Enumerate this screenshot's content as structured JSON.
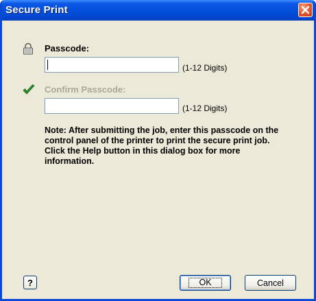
{
  "window": {
    "title": "Secure Print",
    "close_icon": "close-icon"
  },
  "passcode": {
    "label": "Passcode:",
    "value": "",
    "hint": "(1-12 Digits)",
    "icon": "lock-icon"
  },
  "confirm": {
    "label": "Confirm Passcode:",
    "value": "",
    "hint": "(1-12 Digits)",
    "icon": "checkmark-icon",
    "enabled": false
  },
  "note": "Note: After submitting the job, enter this passcode on the control panel of the printer to print the secure print job.  Click the Help button in this dialog box for more information.",
  "buttons": {
    "help": "?",
    "ok": "OK",
    "cancel": "Cancel"
  },
  "colors": {
    "titlebar": "#0350dc",
    "dialog_bg": "#ece9d8",
    "check": "#2e8b2e",
    "disabled_text": "#aca899"
  }
}
